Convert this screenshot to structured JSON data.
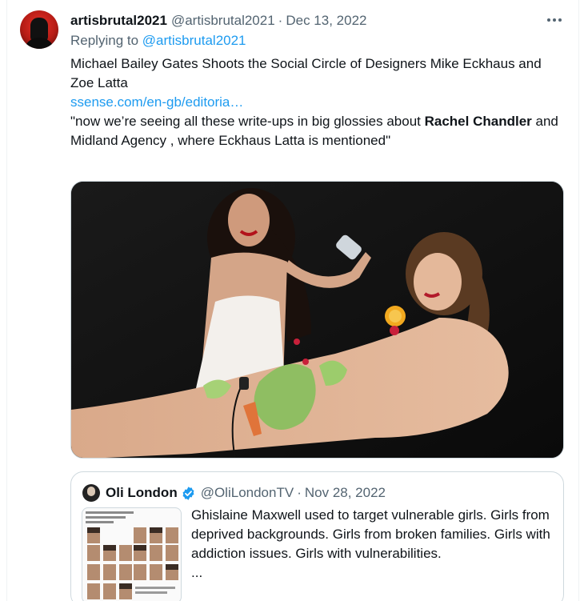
{
  "tweet": {
    "display_name": "artisbrutal2021",
    "handle": "@artisbrutal2021",
    "date": "Dec 13, 2022",
    "more_icon": "more-horizontal-icon",
    "reply_prefix": "Replying to",
    "reply_mention": "@artisbrutal2021",
    "text_line1": "Michael Bailey Gates Shoots the Social Circle of Designers Mike Eckhaus and Zoe Latta",
    "link": "ssense.com/en-gb/editoria…",
    "quote_part1": "\"now we’re seeing all these write-ups in big glossies about ",
    "quote_bold": "Rachel Chandler",
    "quote_part2": " and Midland Agency , where Eckhaus Latta is mentioned\""
  },
  "quoted_tweet": {
    "display_name": "Oli London",
    "handle": "@OliLondonTV",
    "date": "Nov 28, 2022",
    "verified_icon": "verified-badge-icon",
    "text": "Ghislaine Maxwell used to target vulnerable girls. Girls from deprived backgrounds. Girls from broken families. Girls with addiction issues. Girls with vulnerabilities.",
    "ellipsis": "..."
  },
  "colors": {
    "link": "#1d9bf0",
    "secondary_text": "#536471",
    "border": "#cfd9de"
  }
}
